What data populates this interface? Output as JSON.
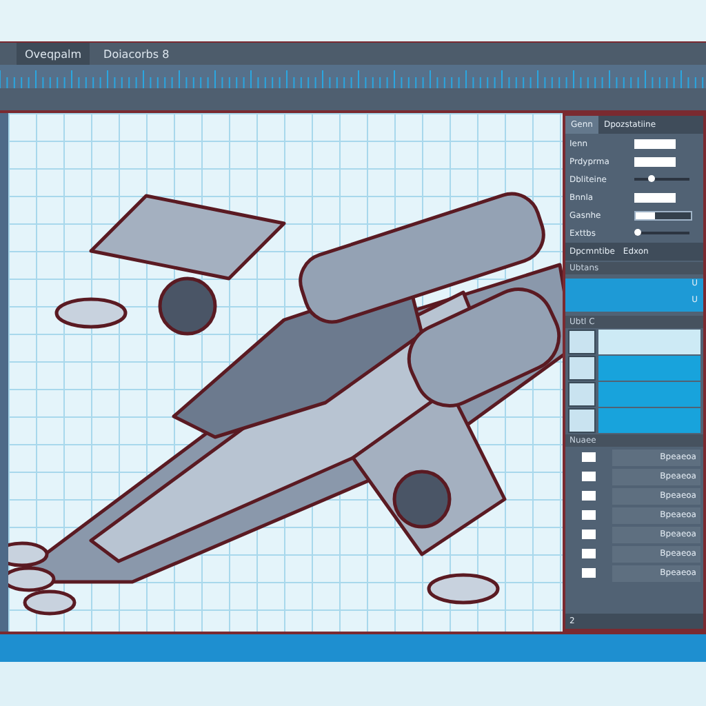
{
  "toolbar": {
    "tabs": [
      {
        "label": "Oveqpalm",
        "selected": true
      },
      {
        "label": "Doiacorbs 8",
        "selected": false
      }
    ]
  },
  "panel": {
    "tabs": [
      {
        "label": "Genn",
        "selected": true
      },
      {
        "label": "Dpozstatiine",
        "selected": false
      }
    ],
    "properties": [
      {
        "label": "Ienn",
        "kind": "field"
      },
      {
        "label": "Prdyprma",
        "kind": "field"
      },
      {
        "label": "Dbliteine",
        "kind": "slider",
        "level": 0.3
      },
      {
        "label": "Bnnla",
        "kind": "field"
      },
      {
        "label": "Gasnhe",
        "kind": "bar",
        "level": 0.35
      },
      {
        "label": "Exttbs",
        "kind": "slider",
        "level": 0.05
      }
    ],
    "section": {
      "title": "Dpcmntibe",
      "action": "Edxon"
    },
    "layers_title": "Ubtans",
    "layers": [
      {
        "label": "U",
        "selected": true
      },
      {
        "label": "U",
        "selected": true
      }
    ],
    "frames_title": "Ubtl C",
    "frames": [
      {
        "selected": false
      },
      {
        "selected": true
      },
      {
        "selected": true
      },
      {
        "selected": true
      }
    ],
    "assets_title": "Nuaee",
    "assets": [
      {
        "label": "Bpeaeoa"
      },
      {
        "label": "Bpeaeoa"
      },
      {
        "label": "Bpeaeoa"
      },
      {
        "label": "Bpeaeoa"
      },
      {
        "label": "Bpeaeoa"
      },
      {
        "label": "Bpeaeoa"
      },
      {
        "label": "Bpeaeoa"
      }
    ],
    "footer": "2"
  }
}
